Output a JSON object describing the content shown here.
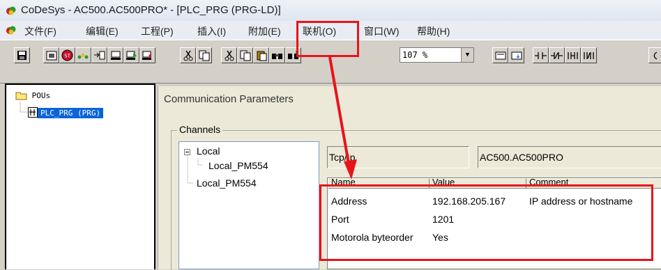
{
  "window": {
    "title": "CoDeSys - AC500.AC500PRO* - [PLC_PRG (PRG-LD)]"
  },
  "menu": [
    {
      "label": "文件(F)"
    },
    {
      "label": "编辑(E)"
    },
    {
      "label": "工程(P)"
    },
    {
      "label": "插入(I)"
    },
    {
      "label": "附加(E)"
    },
    {
      "label": "联机(O)"
    },
    {
      "label": "窗口(W)"
    },
    {
      "label": "帮助(H)"
    }
  ],
  "toolbar": {
    "zoom": "107 %"
  },
  "pou_panel": {
    "root": "POUs",
    "items": [
      {
        "label": "PLC_PRG (PRG)"
      }
    ]
  },
  "dialog": {
    "title": "Communication Parameters",
    "channels_label": "Channels",
    "tree": {
      "root": "Local",
      "child": "Local_PM554",
      "sibling": "Local_PM554"
    },
    "protocol": "Tcp/Ip",
    "device": "AC500.AC500PRO",
    "table": {
      "columns": [
        "Name",
        "Value",
        "Comment"
      ],
      "rows": [
        {
          "name": "Address",
          "value": "192.168.205.167",
          "comment": "IP address or hostname"
        },
        {
          "name": "Port",
          "value": "1201",
          "comment": ""
        },
        {
          "name": "Motorola byteorder",
          "value": "Yes",
          "comment": ""
        }
      ]
    }
  },
  "annotation_color": "#e8141a"
}
